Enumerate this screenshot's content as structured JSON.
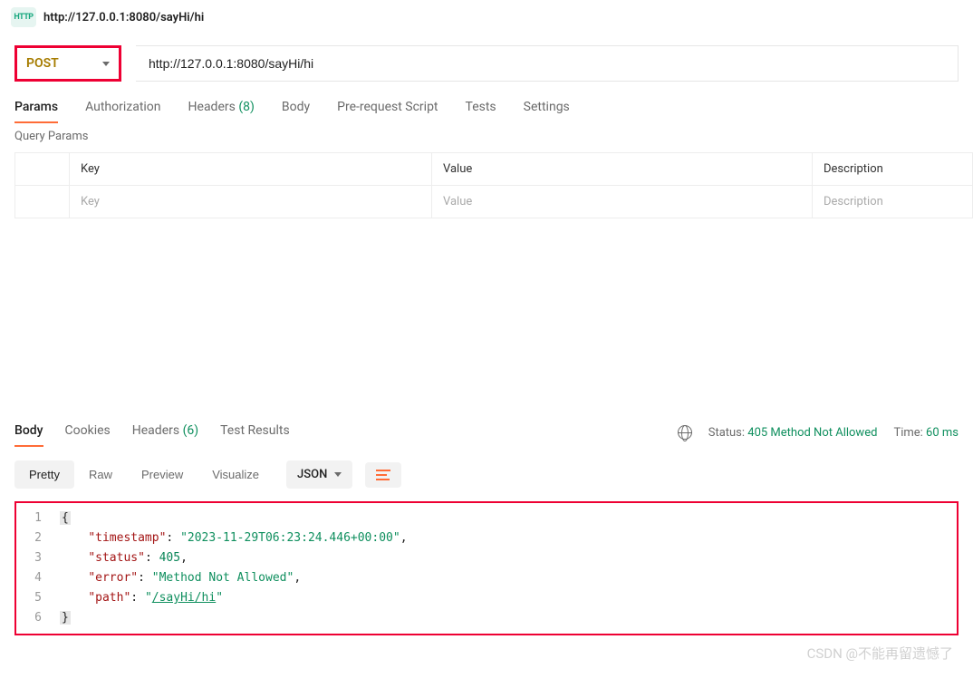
{
  "header": {
    "badge": "HTTP",
    "title": "http://127.0.0.1:8080/sayHi/hi"
  },
  "request": {
    "method": "POST",
    "url": "http://127.0.0.1:8080/sayHi/hi"
  },
  "tabs": {
    "params": "Params",
    "authorization": "Authorization",
    "headers": "Headers",
    "headers_count": "(8)",
    "body": "Body",
    "pre_request": "Pre-request Script",
    "tests": "Tests",
    "settings": "Settings"
  },
  "params_section": {
    "title": "Query Params",
    "headers": {
      "key": "Key",
      "value": "Value",
      "description": "Description"
    },
    "placeholders": {
      "key": "Key",
      "value": "Value",
      "description": "Description"
    }
  },
  "response_tabs": {
    "body": "Body",
    "cookies": "Cookies",
    "headers": "Headers",
    "headers_count": "(6)",
    "test_results": "Test Results"
  },
  "response_meta": {
    "status_label": "Status:",
    "status_value": "405 Method Not Allowed",
    "time_label": "Time:",
    "time_value": "60 ms"
  },
  "response_toolbar": {
    "pretty": "Pretty",
    "raw": "Raw",
    "preview": "Preview",
    "visualize": "Visualize",
    "format": "JSON"
  },
  "response_body": {
    "line_numbers": [
      "1",
      "2",
      "3",
      "4",
      "5",
      "6"
    ],
    "open_brace": "{",
    "close_brace": "}",
    "timestamp_key": "\"timestamp\"",
    "timestamp_val": "\"2023-11-29T06:23:24.446+00:00\"",
    "status_key": "\"status\"",
    "status_val": "405",
    "error_key": "\"error\"",
    "error_val": "\"Method Not Allowed\"",
    "path_key": "\"path\"",
    "path_val_prefix": "\"",
    "path_val_link": "/sayHi/hi",
    "path_val_suffix": "\"",
    "colon_sp": ": ",
    "comma": ","
  },
  "watermark": "CSDN @不能再留遗憾了"
}
